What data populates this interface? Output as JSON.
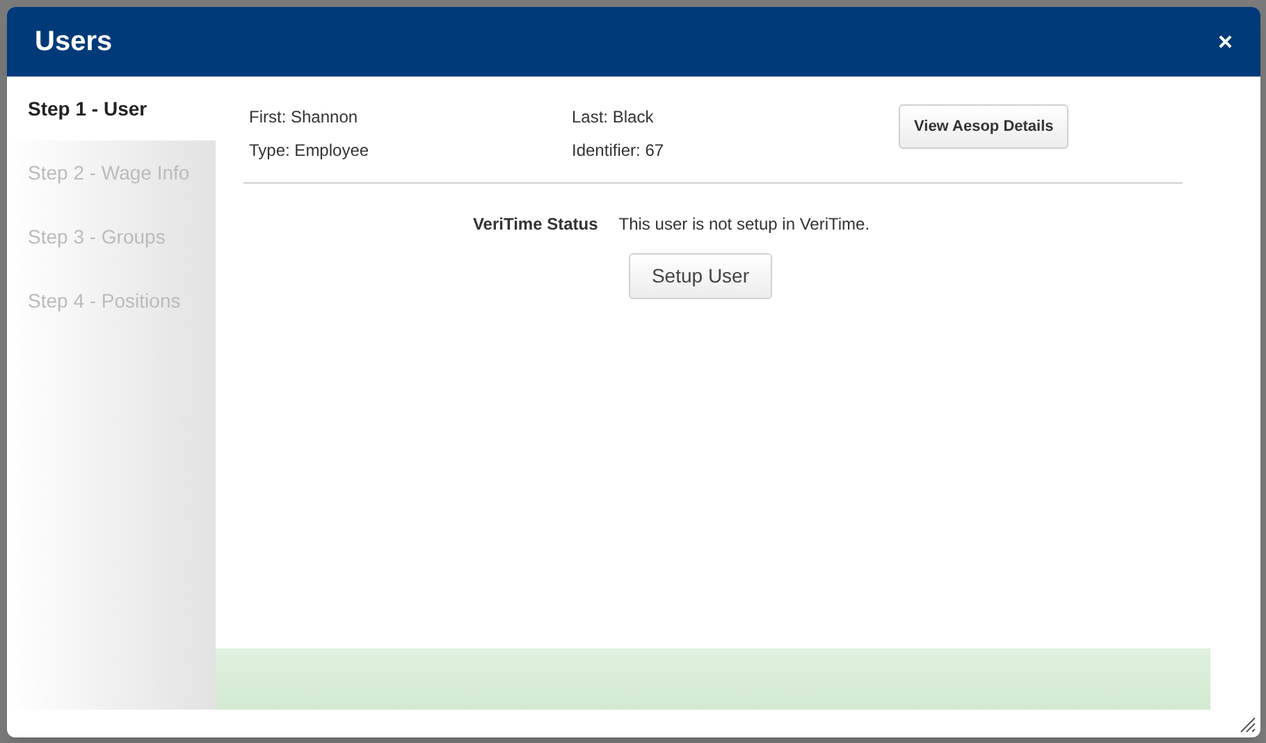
{
  "window": {
    "title": "Users",
    "close": "×"
  },
  "steps": [
    {
      "label": "Step 1 - User",
      "selected": true
    },
    {
      "label": "Step 2 - Wage Info",
      "selected": false
    },
    {
      "label": "Step 3 - Groups",
      "selected": false
    },
    {
      "label": "Step 4 - Positions",
      "selected": false
    }
  ],
  "details": {
    "first": "First: Shannon",
    "type": "Type: Employee",
    "last": "Last: Black",
    "identifier": "Identifier: 67"
  },
  "aesop_button": "View Aesop Details",
  "status": {
    "label": "VeriTime Status",
    "value": "This user is not setup in VeriTime."
  },
  "setup_button": "Setup User"
}
